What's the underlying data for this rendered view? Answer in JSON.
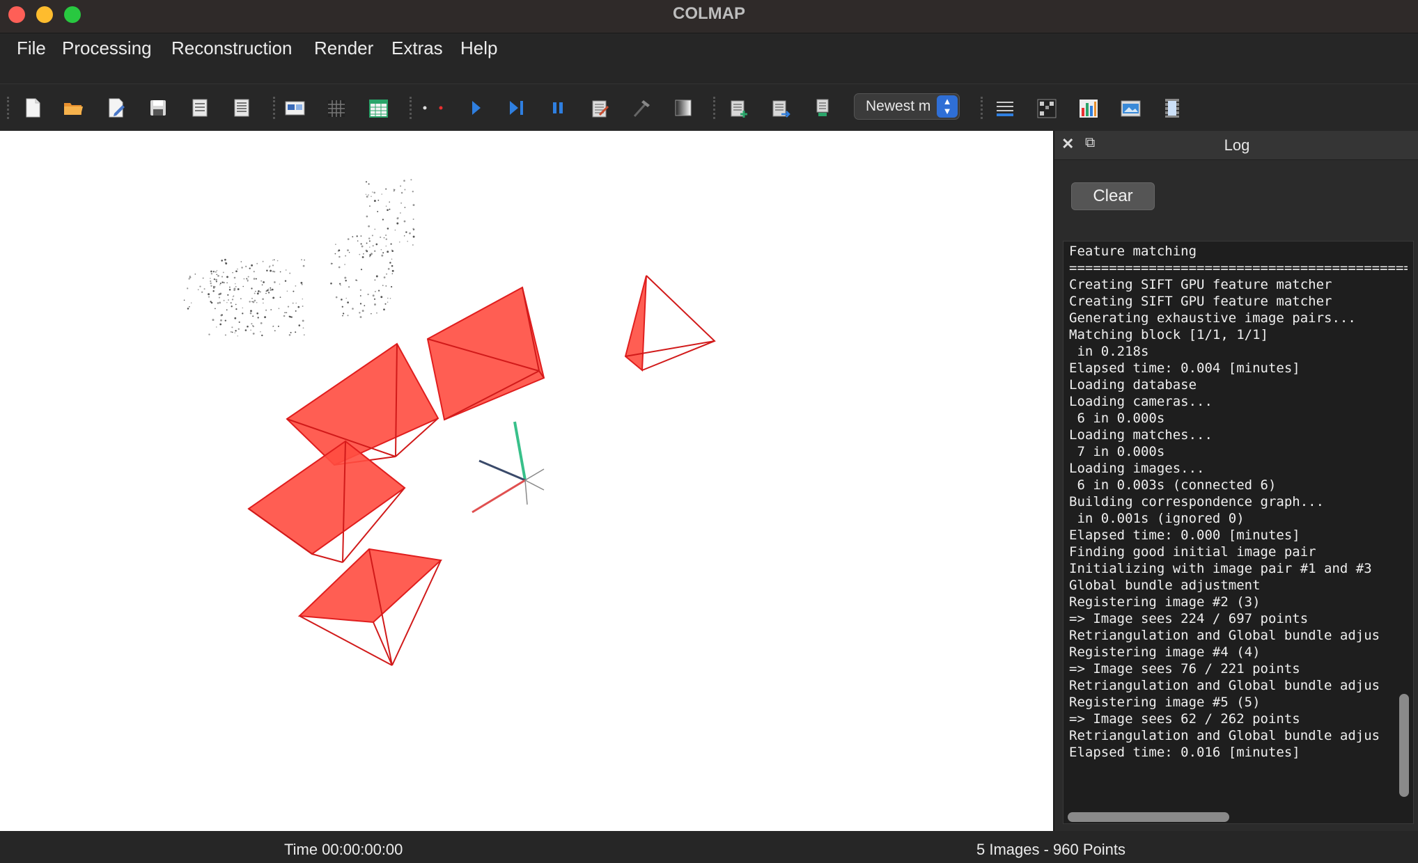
{
  "window": {
    "title": "COLMAP"
  },
  "menu": [
    "File",
    "Processing",
    "Reconstruction",
    "Render",
    "Extras",
    "Help"
  ],
  "toolbar": {
    "icons": [
      "new-project-icon",
      "open-project-icon",
      "edit-project-icon",
      "save-project-icon",
      "import-model-icon",
      "export-model-icon",
      "feature-extraction-icon",
      "feature-matching-icon",
      "database-management-icon",
      "automatic-reconstruction-icon",
      "start-reconstruction-icon",
      "step-reconstruction-icon",
      "pause-reconstruction-icon",
      "reset-reconstruction-icon",
      "bundle-adjustment-icon",
      "dense-reconstruction-icon",
      "render-settings-icon",
      "reset-view-icon",
      "render-options-icon",
      "log-icon",
      "grid-icon",
      "statistics-icon",
      "screenshot-icon",
      "video-icon"
    ],
    "model_select": {
      "value": "Newest m"
    }
  },
  "log": {
    "title": "Log",
    "clear_label": "Clear",
    "lines": [
      "Feature matching",
      "================================================",
      "Creating SIFT GPU feature matcher",
      "Creating SIFT GPU feature matcher",
      "Generating exhaustive image pairs...",
      "Matching block [1/1, 1/1]",
      " in 0.218s",
      "Elapsed time: 0.004 [minutes]",
      "Loading database",
      "Loading cameras...",
      " 6 in 0.000s",
      "Loading matches...",
      " 7 in 0.000s",
      "Loading images...",
      " 6 in 0.003s (connected 6)",
      "Building correspondence graph...",
      " in 0.001s (ignored 0)",
      "Elapsed time: 0.000 [minutes]",
      "Finding good initial image pair",
      "Initializing with image pair #1 and #3",
      "Global bundle adjustment",
      "Registering image #2 (3)",
      "=> Image sees 224 / 697 points",
      "Retriangulation and Global bundle adjus",
      "Registering image #4 (4)",
      "=> Image sees 76 / 221 points",
      "Retriangulation and Global bundle adjus",
      "Registering image #5 (5)",
      "=> Image sees 62 / 262 points",
      "Retriangulation and Global bundle adjus",
      "Elapsed time: 0.016 [minutes]"
    ]
  },
  "status": {
    "time": "Time 00:00:00:00",
    "counts": "5 Images - 960 Points"
  },
  "colors": {
    "camera": "#ff4d40",
    "camera_edge": "#e01e1e",
    "axis_x": "#e05050",
    "axis_y": "#38c08a",
    "axis_z": "#3a4a6a",
    "accent": "#2f6fd6"
  }
}
